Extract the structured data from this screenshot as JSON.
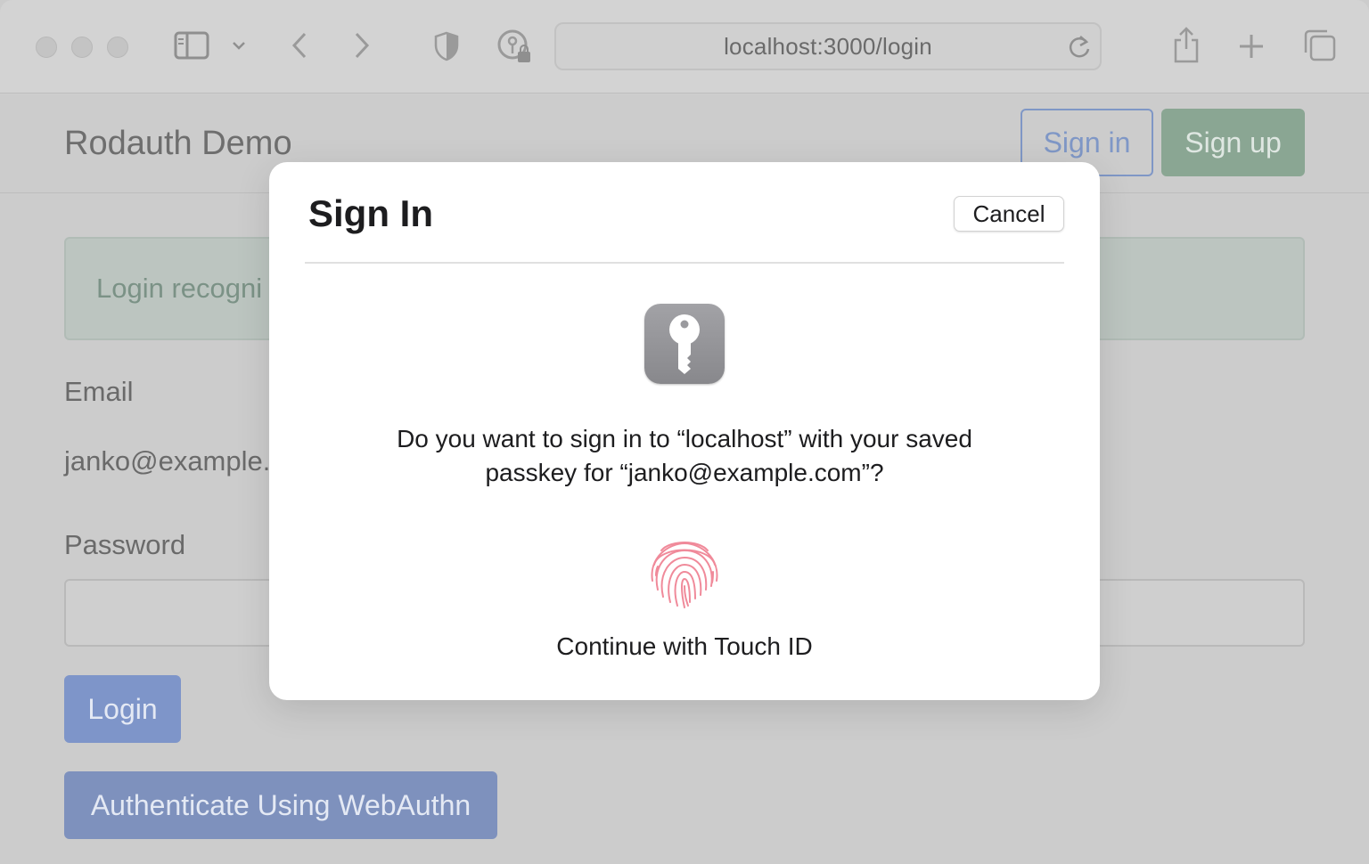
{
  "browser": {
    "url": "localhost:3000/login",
    "icons": {
      "sidebar": "sidebar-icon",
      "sidebar_menu": "chevron-down-icon",
      "back": "chevron-left-icon",
      "forward": "chevron-right-icon",
      "privacy": "shield-icon",
      "passwords": "key-lock-icon",
      "reload": "reload-icon",
      "share": "share-icon",
      "new_tab": "plus-icon",
      "tabs": "tabs-overview-icon"
    }
  },
  "page": {
    "brand": "Rodauth Demo",
    "nav": {
      "sign_in": "Sign in",
      "sign_up": "Sign up"
    },
    "alert": "Login recogni",
    "email_label": "Email",
    "email_value": "janko@example.",
    "password_label": "Password",
    "login_button": "Login",
    "webauthn_button": "Authenticate Using WebAuthn"
  },
  "modal": {
    "title": "Sign In",
    "cancel": "Cancel",
    "prompt_line1": "Do you want to sign in to “localhost” with your saved",
    "prompt_line2": "passkey for “janko@example.com”?",
    "touch_id_label": "Continue with Touch ID",
    "key_icon": "key-icon",
    "fingerprint_icon": "fingerprint-icon"
  },
  "colors": {
    "primary_button": "#7e95c9",
    "success_button": "#8aa693",
    "fingerprint": "#f08a9a"
  }
}
